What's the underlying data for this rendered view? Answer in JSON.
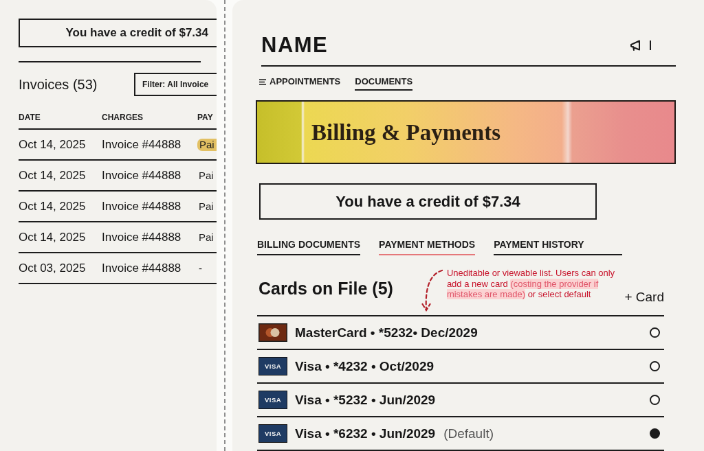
{
  "invoices_panel": {
    "credit_notice": "You have a credit of $7.34",
    "title": "Invoices (53)",
    "filter": {
      "label": "Filter: All Invoice"
    },
    "table": {
      "columns": [
        "DATE",
        "CHARGES",
        "PAY"
      ],
      "rows": [
        {
          "cells": [
            "Oct 14, 2025",
            "Invoice #44888",
            "Pai"
          ],
          "highlighted": true
        },
        {
          "cells": [
            "Oct 14, 2025",
            "Invoice #44888",
            "Pai"
          ],
          "highlighted": false
        },
        {
          "cells": [
            "Oct 14, 2025",
            "Invoice #44888",
            "Pai"
          ],
          "highlighted": false
        },
        {
          "cells": [
            "Oct 14, 2025",
            "Invoice #44888",
            "Pai"
          ],
          "highlighted": false
        },
        {
          "cells": [
            "Oct 03, 2025",
            "Invoice #44888",
            "-"
          ],
          "highlighted": false
        }
      ]
    }
  },
  "header": {
    "title": "NAME"
  },
  "nav": [
    {
      "kind": "menu",
      "label": "APPOINTMENTS",
      "selected": false
    },
    {
      "kind": "link",
      "label": "DOCUMENTS",
      "selected": true
    }
  ],
  "banner": {
    "title": "Billing & Payments"
  },
  "credit_notice": "You have a credit of $7.34",
  "tabs": [
    {
      "label": "BILLING DOCUMENTS",
      "selected": false
    },
    {
      "label": "PAYMENT METHODS",
      "selected": true
    },
    {
      "label": "PAYMENT HISTORY",
      "selected": false
    }
  ],
  "cards_section": {
    "title": "Cards on File (5)",
    "annotation": {
      "segments": [
        {
          "text": "Uneditable or viewable list. Users can only add a new card ",
          "highlighted": false
        },
        {
          "text": "(costing the provider if mistakes are made)",
          "highlighted": true
        },
        {
          "text": " or select default",
          "highlighted": false
        }
      ]
    },
    "add_button": "+ Card",
    "cards": [
      {
        "kind": "mastercard",
        "text": "MasterCard • *5232• Dec/2029",
        "selected": false
      },
      {
        "kind": "visa",
        "logo_text": "VISA",
        "text": "Visa • *4232 • Oct/2029",
        "selected": false
      },
      {
        "kind": "visa",
        "logo_text": "VISA",
        "text": "Visa • *5232 • Jun/2029",
        "selected": false
      },
      {
        "kind": "visa",
        "logo_text": "VISA",
        "text": "Visa • *6232 • Jun/2029",
        "note": "(Default)",
        "selected": true
      }
    ]
  }
}
